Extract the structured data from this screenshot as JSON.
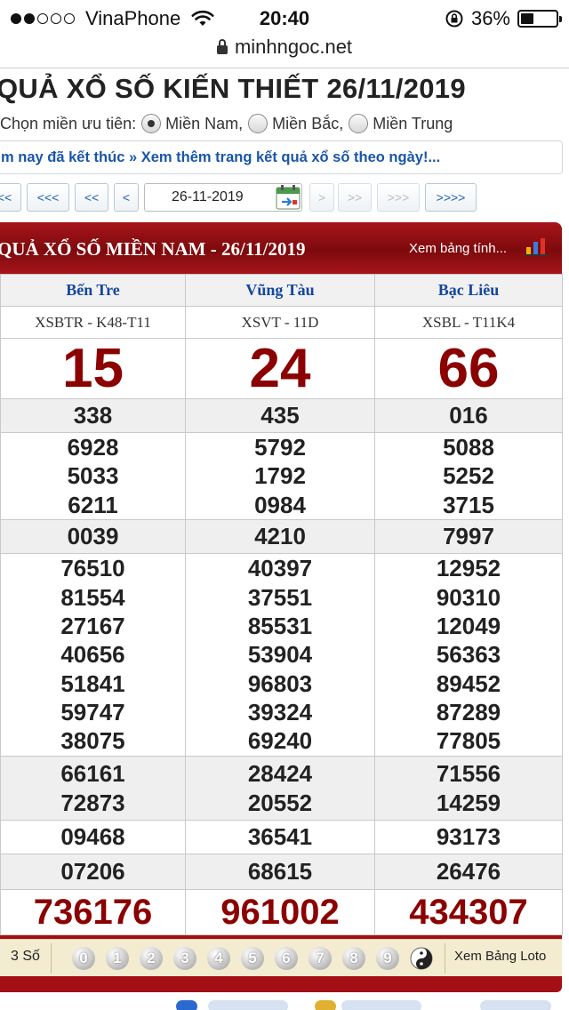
{
  "status_bar": {
    "carrier": "VinaPhone",
    "time": "20:40",
    "battery_percent": "36%",
    "battery_level": 0.36,
    "signal_dots_filled": 2,
    "signal_dots_total": 5
  },
  "browser": {
    "url": "minhngoc.net"
  },
  "page": {
    "title": "QUẢ XỔ SỐ KIẾN THIẾT 26/11/2019",
    "region_prompt": "Chọn miền ưu tiên:",
    "regions": [
      {
        "label": "Miền Nam,",
        "selected": true
      },
      {
        "label": "Miền Bắc,",
        "selected": false
      },
      {
        "label": "Miền Trung",
        "selected": false
      }
    ],
    "notice": "m nay đã kết thúc » Xem thêm trang kết quả xổ số theo ngày!..."
  },
  "pager": {
    "buttons_left": [
      "<<",
      "<<<",
      "<<",
      "<"
    ],
    "date": "26-11-2019",
    "buttons_right": [
      ">",
      ">>",
      ">>>",
      ">>>>"
    ]
  },
  "result": {
    "header_title": "QUẢ XỔ SỐ MIỀN NAM - 26/11/2019",
    "header_link": "Xem bảng tính...",
    "provinces": [
      "Bến Tre",
      "Vũng Tàu",
      "Bạc Liêu"
    ],
    "ticket_codes": [
      "XSBTR - K48-T11",
      "XSVT - 11D",
      "XSBL - T11K4"
    ],
    "prizes": [
      {
        "key": "g8",
        "values": [
          [
            "15"
          ],
          [
            "24"
          ],
          [
            "66"
          ]
        ]
      },
      {
        "key": "g7",
        "values": [
          [
            "338"
          ],
          [
            "435"
          ],
          [
            "016"
          ]
        ]
      },
      {
        "key": "g6",
        "values": [
          [
            "6928",
            "5033",
            "6211"
          ],
          [
            "5792",
            "1792",
            "0984"
          ],
          [
            "5088",
            "5252",
            "3715"
          ]
        ]
      },
      {
        "key": "g5",
        "values": [
          [
            "0039"
          ],
          [
            "4210"
          ],
          [
            "7997"
          ]
        ]
      },
      {
        "key": "g4",
        "values": [
          [
            "76510",
            "81554",
            "27167",
            "40656",
            "51841",
            "59747",
            "38075"
          ],
          [
            "40397",
            "37551",
            "85531",
            "53904",
            "96803",
            "39324",
            "69240"
          ],
          [
            "12952",
            "90310",
            "12049",
            "56363",
            "89452",
            "87289",
            "77805"
          ]
        ]
      },
      {
        "key": "g3",
        "values": [
          [
            "66161",
            "72873"
          ],
          [
            "28424",
            "20552"
          ],
          [
            "71556",
            "14259"
          ]
        ]
      },
      {
        "key": "g2",
        "values": [
          [
            "09468"
          ],
          [
            "36541"
          ],
          [
            "93173"
          ]
        ]
      },
      {
        "key": "g1",
        "values": [
          [
            "07206"
          ],
          [
            "68615"
          ],
          [
            "26476"
          ]
        ]
      },
      {
        "key": "db",
        "values": [
          [
            "736176"
          ],
          [
            "961002"
          ],
          [
            "434307"
          ]
        ]
      }
    ],
    "loto": {
      "label": "3 Số",
      "digits": [
        "0",
        "1",
        "2",
        "3",
        "4",
        "5",
        "6",
        "7",
        "8",
        "9"
      ],
      "yin_yang_icon": "yin-yang-icon",
      "link": "Xem Bảng Loto"
    }
  },
  "colors": {
    "panel_red": "#a30f14",
    "prize_red": "#8b0000",
    "link_blue": "#1a56a8",
    "province_blue": "#1546a0"
  }
}
